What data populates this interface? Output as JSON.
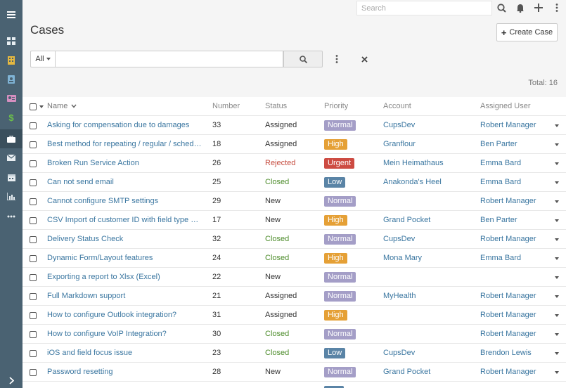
{
  "topbar": {
    "search_placeholder": "Search"
  },
  "sidebar": {
    "items": [
      {
        "icon": "menu-icon"
      },
      {
        "icon": "dashboard-icon"
      },
      {
        "icon": "building-icon"
      },
      {
        "icon": "contact-book-icon"
      },
      {
        "icon": "id-card-icon"
      },
      {
        "icon": "dollar-icon"
      },
      {
        "icon": "briefcase-icon"
      },
      {
        "icon": "envelope-icon"
      },
      {
        "icon": "calendar-icon"
      },
      {
        "icon": "report-icon"
      },
      {
        "icon": "more-icon"
      }
    ]
  },
  "page": {
    "title": "Cases",
    "create_label": "Create Case"
  },
  "filter": {
    "all_label": "All",
    "value": ""
  },
  "list": {
    "total": "Total: 16",
    "columns": {
      "name": "Name",
      "number": "Number",
      "status": "Status",
      "priority": "Priority",
      "account": "Account",
      "assigned": "Assigned User"
    },
    "rows": [
      {
        "name": "Asking for compensation due to damages",
        "number": "33",
        "status": "Assigned",
        "priority": "Normal",
        "account": "CupsDev",
        "user": "Robert Manager"
      },
      {
        "name": "Best method for repeating / regular / scheduled...",
        "number": "18",
        "status": "Assigned",
        "priority": "High",
        "account": "Granflour",
        "user": "Ben Parter"
      },
      {
        "name": "Broken Run Service Action",
        "number": "26",
        "status": "Rejected",
        "priority": "Urgent",
        "account": "Mein Heimathaus",
        "user": "Emma Bard"
      },
      {
        "name": "Can not send email",
        "number": "25",
        "status": "Closed",
        "priority": "Low",
        "account": "Anakonda's Heel",
        "user": "Emma Bard"
      },
      {
        "name": "Cannot configure SMTP settings",
        "number": "29",
        "status": "New",
        "priority": "Normal",
        "account": "",
        "user": "Robert Manager"
      },
      {
        "name": "CSV Import of customer ID with field type Number",
        "number": "17",
        "status": "New",
        "priority": "High",
        "account": "Grand Pocket",
        "user": "Ben Parter"
      },
      {
        "name": "Delivery Status Check",
        "number": "32",
        "status": "Closed",
        "priority": "Normal",
        "account": "CupsDev",
        "user": "Robert Manager"
      },
      {
        "name": "Dynamic Form/Layout features",
        "number": "24",
        "status": "Closed",
        "priority": "High",
        "account": "Mona Mary",
        "user": "Emma Bard"
      },
      {
        "name": "Exporting a report to Xlsx (Excel)",
        "number": "22",
        "status": "New",
        "priority": "Normal",
        "account": "",
        "user": ""
      },
      {
        "name": "Full Markdown support",
        "number": "21",
        "status": "Assigned",
        "priority": "Normal",
        "account": "MyHealth",
        "user": "Robert Manager"
      },
      {
        "name": "How to configure Outlook integration?",
        "number": "31",
        "status": "Assigned",
        "priority": "High",
        "account": "",
        "user": "Robert Manager"
      },
      {
        "name": "How to configure VoIP Integration?",
        "number": "30",
        "status": "Closed",
        "priority": "Normal",
        "account": "",
        "user": "Robert Manager"
      },
      {
        "name": "iOS and field focus issue",
        "number": "23",
        "status": "Closed",
        "priority": "Low",
        "account": "CupsDev",
        "user": "Brendon Lewis"
      },
      {
        "name": "Password resetting",
        "number": "28",
        "status": "New",
        "priority": "Normal",
        "account": "Grand Pocket",
        "user": "Robert Manager"
      }
    ]
  },
  "colors": {
    "sidebar": "#4a6272",
    "link": "#3a76a0",
    "normal": "#a49ec7",
    "high": "#e5a036",
    "urgent": "#cd4b42",
    "low": "#5a84a6",
    "closed": "#4d8c2b",
    "rejected": "#c54a3d"
  }
}
